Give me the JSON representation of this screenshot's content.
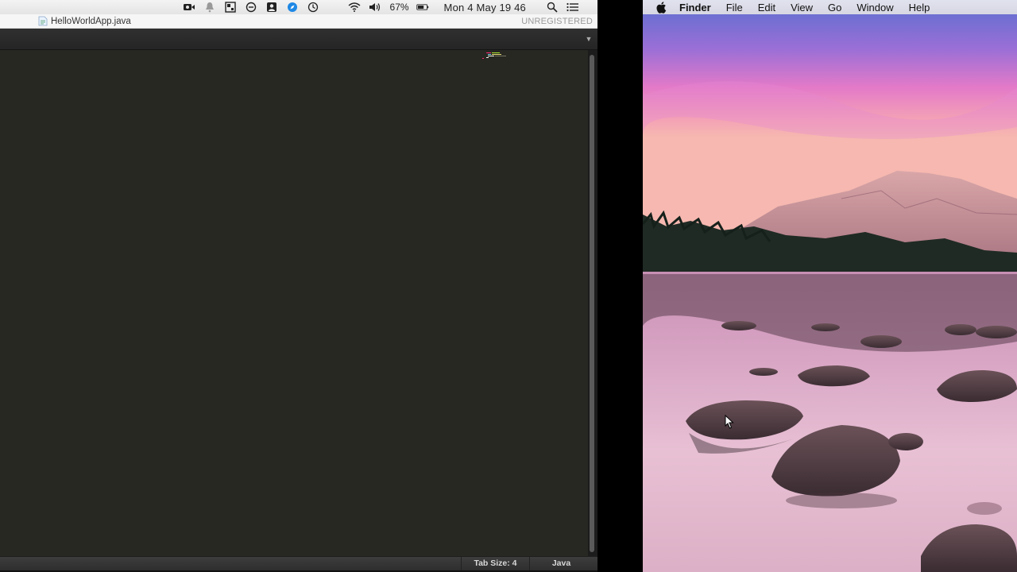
{
  "left_screen": {
    "menubar": {
      "icons": [
        "video-camera-icon",
        "notification-bell-icon",
        "window-layout-icon",
        "circle-icon",
        "user-card-icon",
        "safari-icon",
        "time-machine-icon",
        "wifi-icon",
        "volume-icon",
        "battery-icon",
        "spotlight-search-icon",
        "notification-center-icon"
      ],
      "battery_percent": "67%",
      "clock": "Mon 4 May  19 46"
    },
    "titlebar": {
      "filename": "HelloWorldApp.java",
      "registration": "UNREGISTERED"
    },
    "statusbar": {
      "tab_size": "Tab Size: 4",
      "syntax": "Java"
    },
    "colors": {
      "editor_bg": "#272822",
      "tab_bar": "#2a2a2a"
    }
  },
  "right_screen": {
    "menubar": {
      "apple_icon": "apple-icon",
      "app_name": "Finder",
      "items": [
        "File",
        "Edit",
        "View",
        "Go",
        "Window",
        "Help"
      ]
    },
    "wallpaper": "mountain-lake-sunset"
  }
}
